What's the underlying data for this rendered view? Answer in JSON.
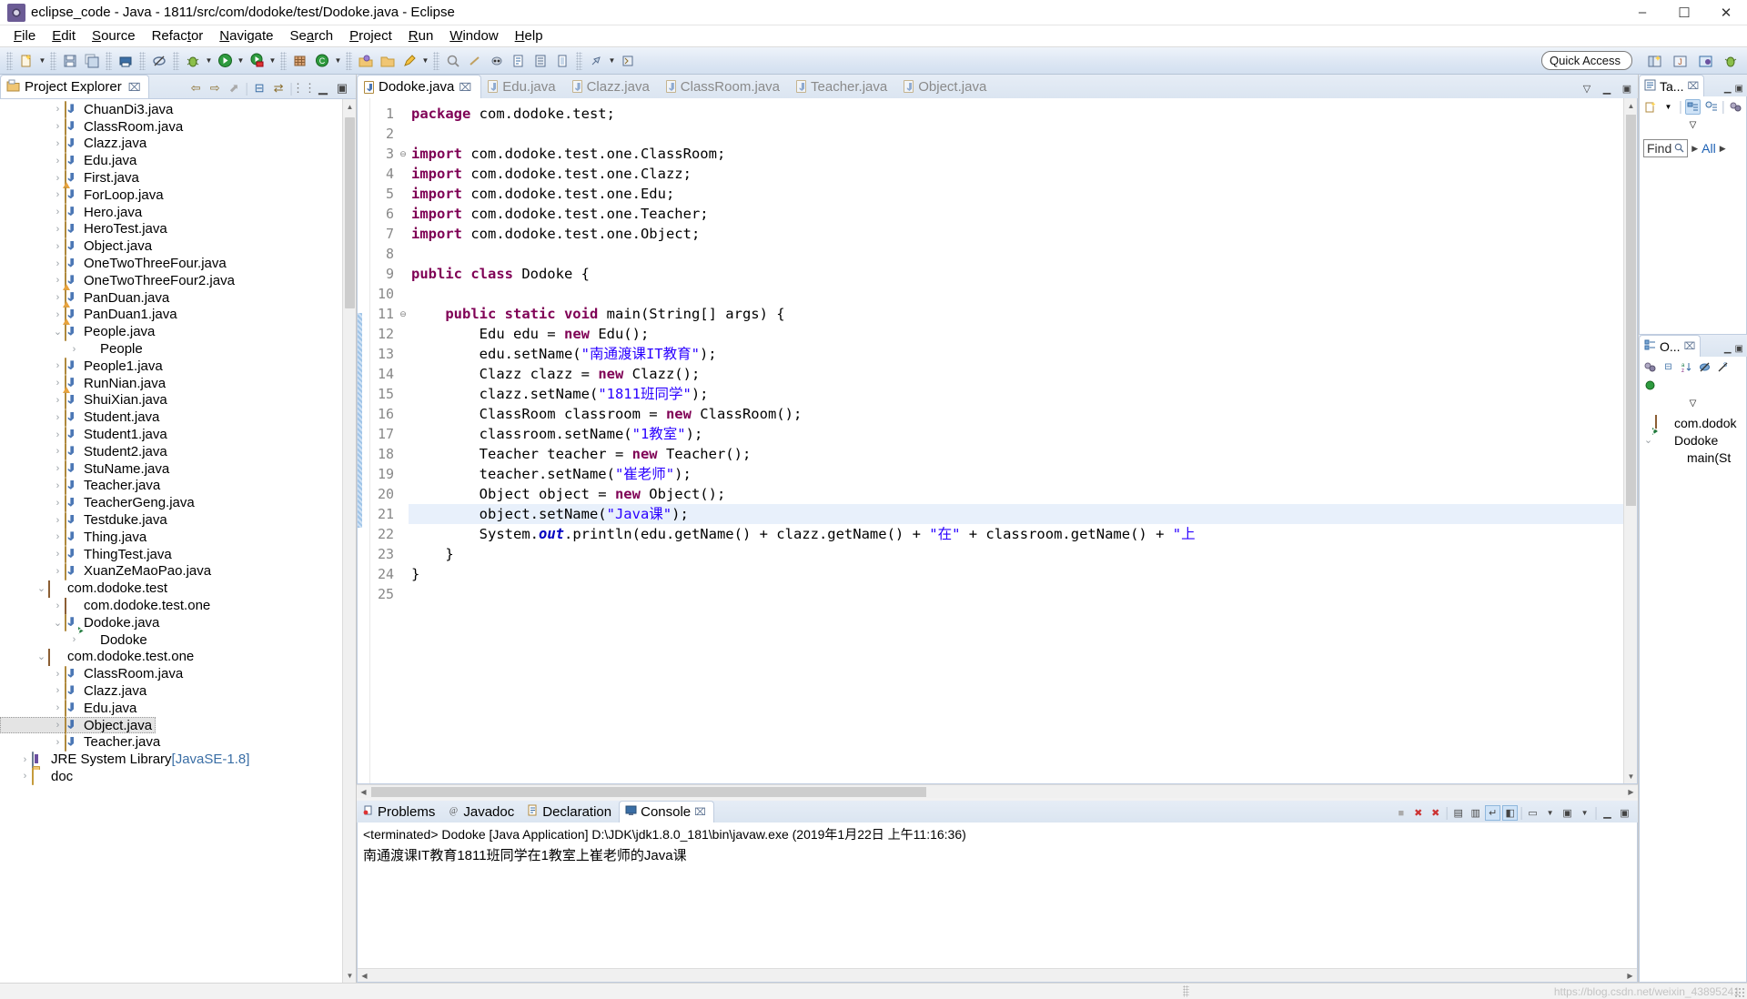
{
  "window": {
    "title": "eclipse_code - Java - 1811/src/com/dodoke/test/Dodoke.java - Eclipse",
    "app_icon": "eclipse-icon",
    "minimize": "–",
    "maximize": "☐",
    "close": "✕"
  },
  "menu": {
    "items": [
      "File",
      "Edit",
      "Source",
      "Refactor",
      "Navigate",
      "Search",
      "Project",
      "Run",
      "Window",
      "Help"
    ]
  },
  "toolbar": {
    "quick_access_placeholder": "Quick Access",
    "buttons": [
      "new-wizard-icon",
      "save-icon",
      "save-all-icon",
      "print-icon",
      "toggle-mark-occurrences-icon",
      "debug-icon",
      "run-icon",
      "run-coverage-icon",
      "new-java-package-icon",
      "new-java-class-icon",
      "open-type-icon",
      "open-task-icon",
      "search-icon",
      "next-annotation-icon",
      "previous-annotation-icon",
      "last-edit-location-icon",
      "back-icon",
      "forward-icon",
      "pin-editor-icon"
    ],
    "perspective_buttons": [
      "open-perspective-icon",
      "java-perspective-icon",
      "java-ee-perspective-icon",
      "debug-perspective-icon"
    ]
  },
  "project_explorer": {
    "title": "Project Explorer",
    "close_label": "⌧",
    "toolbar_icons": [
      "back-arrow-icon",
      "forward-arrow-icon",
      "up-arrow-icon",
      "collapse-all-icon",
      "link-with-editor-icon",
      "view-menu-icon",
      "minimize-icon",
      "maximize-icon"
    ],
    "tree": [
      {
        "label": "ChuanDi3.java",
        "icon": "java-file-icon",
        "indent": 3,
        "twisty": "collapsed"
      },
      {
        "label": "ClassRoom.java",
        "icon": "java-file-icon",
        "indent": 3,
        "twisty": "collapsed"
      },
      {
        "label": "Clazz.java",
        "icon": "java-file-icon",
        "indent": 3,
        "twisty": "collapsed"
      },
      {
        "label": "Edu.java",
        "icon": "java-file-icon",
        "indent": 3,
        "twisty": "collapsed"
      },
      {
        "label": "First.java",
        "icon": "java-file-warn-icon",
        "indent": 3,
        "twisty": "collapsed"
      },
      {
        "label": "ForLoop.java",
        "icon": "java-file-icon",
        "indent": 3,
        "twisty": "collapsed"
      },
      {
        "label": "Hero.java",
        "icon": "java-file-icon",
        "indent": 3,
        "twisty": "collapsed"
      },
      {
        "label": "HeroTest.java",
        "icon": "java-file-icon",
        "indent": 3,
        "twisty": "collapsed"
      },
      {
        "label": "Object.java",
        "icon": "java-file-icon",
        "indent": 3,
        "twisty": "collapsed"
      },
      {
        "label": "OneTwoThreeFour.java",
        "icon": "java-file-icon",
        "indent": 3,
        "twisty": "collapsed"
      },
      {
        "label": "OneTwoThreeFour2.java",
        "icon": "java-file-warn-icon",
        "indent": 3,
        "twisty": "collapsed"
      },
      {
        "label": "PanDuan.java",
        "icon": "java-file-warn-icon",
        "indent": 3,
        "twisty": "collapsed"
      },
      {
        "label": "PanDuan1.java",
        "icon": "java-file-warn-icon",
        "indent": 3,
        "twisty": "collapsed"
      },
      {
        "label": "People.java",
        "icon": "java-file-icon",
        "indent": 3,
        "twisty": "expanded"
      },
      {
        "label": "People",
        "icon": "java-class-icon",
        "indent": 4,
        "twisty": "collapsed"
      },
      {
        "label": "People1.java",
        "icon": "java-file-icon",
        "indent": 3,
        "twisty": "collapsed"
      },
      {
        "label": "RunNian.java",
        "icon": "java-file-warn-icon",
        "indent": 3,
        "twisty": "collapsed"
      },
      {
        "label": "ShuiXian.java",
        "icon": "java-file-icon",
        "indent": 3,
        "twisty": "collapsed"
      },
      {
        "label": "Student.java",
        "icon": "java-file-icon",
        "indent": 3,
        "twisty": "collapsed"
      },
      {
        "label": "Student1.java",
        "icon": "java-file-icon",
        "indent": 3,
        "twisty": "collapsed"
      },
      {
        "label": "Student2.java",
        "icon": "java-file-icon",
        "indent": 3,
        "twisty": "collapsed"
      },
      {
        "label": "StuName.java",
        "icon": "java-file-icon",
        "indent": 3,
        "twisty": "collapsed"
      },
      {
        "label": "Teacher.java",
        "icon": "java-file-icon",
        "indent": 3,
        "twisty": "collapsed"
      },
      {
        "label": "TeacherGeng.java",
        "icon": "java-file-icon",
        "indent": 3,
        "twisty": "collapsed"
      },
      {
        "label": "Testduke.java",
        "icon": "java-file-icon",
        "indent": 3,
        "twisty": "collapsed"
      },
      {
        "label": "Thing.java",
        "icon": "java-file-icon",
        "indent": 3,
        "twisty": "collapsed"
      },
      {
        "label": "ThingTest.java",
        "icon": "java-file-icon",
        "indent": 3,
        "twisty": "collapsed"
      },
      {
        "label": "XuanZeMaoPao.java",
        "icon": "java-file-icon",
        "indent": 3,
        "twisty": "collapsed"
      },
      {
        "label": "com.dodoke.test",
        "icon": "package-icon",
        "indent": 2,
        "twisty": "expanded"
      },
      {
        "label": "com.dodoke.test.one",
        "icon": "package-icon",
        "indent": 3,
        "twisty": "collapsed"
      },
      {
        "label": "Dodoke.java",
        "icon": "java-file-icon",
        "indent": 3,
        "twisty": "expanded"
      },
      {
        "label": "Dodoke",
        "icon": "java-class-run-icon",
        "indent": 4,
        "twisty": "collapsed"
      },
      {
        "label": "com.dodoke.test.one",
        "icon": "package-icon",
        "indent": 2,
        "twisty": "expanded"
      },
      {
        "label": "ClassRoom.java",
        "icon": "java-file-icon",
        "indent": 3,
        "twisty": "collapsed"
      },
      {
        "label": "Clazz.java",
        "icon": "java-file-icon",
        "indent": 3,
        "twisty": "collapsed"
      },
      {
        "label": "Edu.java",
        "icon": "java-file-icon",
        "indent": 3,
        "twisty": "collapsed"
      },
      {
        "label": "Object.java",
        "icon": "java-file-icon",
        "indent": 3,
        "twisty": "collapsed",
        "selected": true
      },
      {
        "label": "Teacher.java",
        "icon": "java-file-icon",
        "indent": 3,
        "twisty": "collapsed"
      },
      {
        "label": "JRE System Library",
        "suffix": " [JavaSE-1.8]",
        "icon": "jre-library-icon",
        "indent": 1,
        "twisty": "collapsed"
      },
      {
        "label": "doc",
        "icon": "folder-icon",
        "indent": 1,
        "twisty": "collapsed"
      }
    ]
  },
  "editor": {
    "tabs": [
      {
        "label": "Dodoke.java",
        "active": true,
        "close": "⌧"
      },
      {
        "label": "Edu.java",
        "active": false
      },
      {
        "label": "Clazz.java",
        "active": false
      },
      {
        "label": "ClassRoom.java",
        "active": false
      },
      {
        "label": "Teacher.java",
        "active": false
      },
      {
        "label": "Object.java",
        "active": false
      }
    ],
    "highlighted_line": 21,
    "lines": [
      {
        "n": 1,
        "fold": "",
        "tokens": [
          {
            "t": "package",
            "c": "kw"
          },
          {
            "t": " com.dodoke.test;",
            "c": "plain"
          }
        ]
      },
      {
        "n": 2,
        "fold": "",
        "tokens": []
      },
      {
        "n": 3,
        "fold": "⊖",
        "tokens": [
          {
            "t": "import",
            "c": "kw"
          },
          {
            "t": " com.dodoke.test.one.ClassRoom;",
            "c": "plain"
          }
        ]
      },
      {
        "n": 4,
        "fold": "",
        "tokens": [
          {
            "t": "import",
            "c": "kw"
          },
          {
            "t": " com.dodoke.test.one.Clazz;",
            "c": "plain"
          }
        ]
      },
      {
        "n": 5,
        "fold": "",
        "tokens": [
          {
            "t": "import",
            "c": "kw"
          },
          {
            "t": " com.dodoke.test.one.Edu;",
            "c": "plain"
          }
        ]
      },
      {
        "n": 6,
        "fold": "",
        "tokens": [
          {
            "t": "import",
            "c": "kw"
          },
          {
            "t": " com.dodoke.test.one.Teacher;",
            "c": "plain"
          }
        ]
      },
      {
        "n": 7,
        "fold": "",
        "tokens": [
          {
            "t": "import",
            "c": "kw"
          },
          {
            "t": " com.dodoke.test.one.Object;",
            "c": "plain"
          }
        ]
      },
      {
        "n": 8,
        "fold": "",
        "tokens": []
      },
      {
        "n": 9,
        "fold": "",
        "tokens": [
          {
            "t": "public class",
            "c": "kw"
          },
          {
            "t": " Dodoke {",
            "c": "plain"
          }
        ]
      },
      {
        "n": 10,
        "fold": "",
        "tokens": []
      },
      {
        "n": 11,
        "fold": "⊖",
        "tokens": [
          {
            "t": "    ",
            "c": "plain"
          },
          {
            "t": "public static void",
            "c": "kw"
          },
          {
            "t": " main(String[] args) {",
            "c": "plain"
          }
        ]
      },
      {
        "n": 12,
        "fold": "",
        "tokens": [
          {
            "t": "        Edu edu = ",
            "c": "plain"
          },
          {
            "t": "new",
            "c": "kw"
          },
          {
            "t": " Edu();",
            "c": "plain"
          }
        ]
      },
      {
        "n": 13,
        "fold": "",
        "tokens": [
          {
            "t": "        edu.setName(",
            "c": "plain"
          },
          {
            "t": "\"南通渡课IT教育\"",
            "c": "str"
          },
          {
            "t": ");",
            "c": "plain"
          }
        ]
      },
      {
        "n": 14,
        "fold": "",
        "tokens": [
          {
            "t": "        Clazz clazz = ",
            "c": "plain"
          },
          {
            "t": "new",
            "c": "kw"
          },
          {
            "t": " Clazz();",
            "c": "plain"
          }
        ]
      },
      {
        "n": 15,
        "fold": "",
        "tokens": [
          {
            "t": "        clazz.setName(",
            "c": "plain"
          },
          {
            "t": "\"1811班同学\"",
            "c": "str"
          },
          {
            "t": ");",
            "c": "plain"
          }
        ]
      },
      {
        "n": 16,
        "fold": "",
        "tokens": [
          {
            "t": "        ClassRoom classroom = ",
            "c": "plain"
          },
          {
            "t": "new",
            "c": "kw"
          },
          {
            "t": " ClassRoom();",
            "c": "plain"
          }
        ]
      },
      {
        "n": 17,
        "fold": "",
        "tokens": [
          {
            "t": "        classroom.setName(",
            "c": "plain"
          },
          {
            "t": "\"1教室\"",
            "c": "str"
          },
          {
            "t": ");",
            "c": "plain"
          }
        ]
      },
      {
        "n": 18,
        "fold": "",
        "tokens": [
          {
            "t": "        Teacher teacher = ",
            "c": "plain"
          },
          {
            "t": "new",
            "c": "kw"
          },
          {
            "t": " Teacher();",
            "c": "plain"
          }
        ]
      },
      {
        "n": 19,
        "fold": "",
        "tokens": [
          {
            "t": "        teacher.setName(",
            "c": "plain"
          },
          {
            "t": "\"崔老师\"",
            "c": "str"
          },
          {
            "t": ");",
            "c": "plain"
          }
        ]
      },
      {
        "n": 20,
        "fold": "",
        "tokens": [
          {
            "t": "        Object object = ",
            "c": "plain"
          },
          {
            "t": "new",
            "c": "kw"
          },
          {
            "t": " Object();",
            "c": "plain"
          }
        ]
      },
      {
        "n": 21,
        "fold": "",
        "tokens": [
          {
            "t": "        object.setName(",
            "c": "plain"
          },
          {
            "t": "\"Java课\"",
            "c": "str"
          },
          {
            "t": ");",
            "c": "plain"
          }
        ]
      },
      {
        "n": 22,
        "fold": "",
        "tokens": [
          {
            "t": "        System.",
            "c": "plain"
          },
          {
            "t": "out",
            "c": "fld"
          },
          {
            "t": ".println(edu.getName() + clazz.getName() + ",
            "c": "plain"
          },
          {
            "t": "\"在\"",
            "c": "str"
          },
          {
            "t": " + classroom.getName() + ",
            "c": "plain"
          },
          {
            "t": "\"上",
            "c": "str"
          }
        ]
      },
      {
        "n": 23,
        "fold": "",
        "tokens": [
          {
            "t": "    }",
            "c": "plain"
          }
        ]
      },
      {
        "n": 24,
        "fold": "",
        "tokens": [
          {
            "t": "}",
            "c": "plain"
          }
        ]
      },
      {
        "n": 25,
        "fold": "",
        "tokens": []
      }
    ]
  },
  "bottom": {
    "tabs": [
      {
        "label": "Problems",
        "icon": "problems-icon",
        "active": false
      },
      {
        "label": "Javadoc",
        "icon": "javadoc-icon",
        "active": false
      },
      {
        "label": "Declaration",
        "icon": "declaration-icon",
        "active": false
      },
      {
        "label": "Console",
        "icon": "console-icon",
        "active": true,
        "close": "⌧"
      }
    ],
    "tools": [
      "terminate-icon",
      "remove-launch-icon",
      "remove-all-terminated-icon",
      "clear-console-icon",
      "scroll-lock-icon",
      "word-wrap-icon",
      "pin-console-icon",
      "display-selected-console-icon",
      "open-console-icon",
      "view-menu-icon",
      "minimize-icon",
      "maximize-icon"
    ],
    "console_header": "<terminated> Dodoke [Java Application] D:\\JDK\\jdk1.8.0_181\\bin\\javaw.exe (2019年1月22日 上午11:16:36)",
    "console_output": "南通渡课IT教育1811班同学在1教室上崔老师的Java课"
  },
  "task_list": {
    "title": "Ta...",
    "close": "⌧",
    "find_label": "Find",
    "find_icon": "search-icon",
    "all_label": "All",
    "tools": [
      "new-task-icon",
      "dropdown-icon",
      "categorize-by-icon",
      "schedule-icon",
      "collapse-all-icon",
      "view-menu-icon"
    ]
  },
  "outline": {
    "title": "O...",
    "close": "⌧",
    "tools": [
      "focus-active-task-icon",
      "collapse-all-icon",
      "sort-icon",
      "hide-fields-icon",
      "hide-static-icon",
      "hide-nonpublic-icon"
    ],
    "items": [
      {
        "label": "com.dodok",
        "icon": "package-icon",
        "indent": 0,
        "twisty": "none"
      },
      {
        "label": "Dodoke",
        "icon": "java-class-run-icon",
        "indent": 0,
        "twisty": "expanded"
      },
      {
        "label": "main(St",
        "icon": "method-icon",
        "indent": 1,
        "twisty": "none"
      }
    ]
  },
  "status_bar": {
    "watermark": "https://blog.csdn.net/weixin_43895241"
  }
}
